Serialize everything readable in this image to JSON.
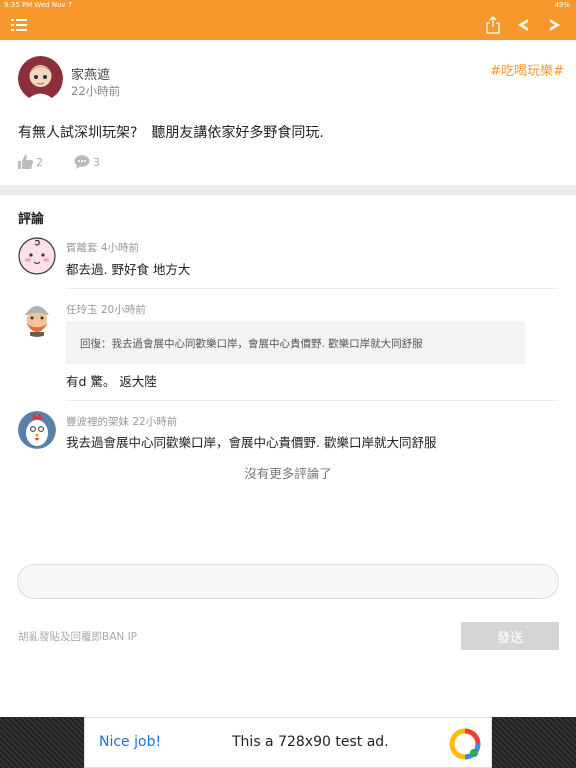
{
  "status_bar": {
    "time_date": "9:35 PM   Wed Nov 7",
    "battery": "49%"
  },
  "nav": {
    "icons": [
      "list-icon",
      "share-icon",
      "back-arrow-icon",
      "forward-arrow-icon"
    ]
  },
  "post": {
    "author": "家燕遮",
    "time": "22小時前",
    "tag": "#吃喝玩樂#",
    "content": "有無人試深圳玩架?　聽朋友講依家好多野食同玩.",
    "likes": "2",
    "comments": "3"
  },
  "comments_section": {
    "title": "評論",
    "items": [
      {
        "meta": "賓離套 4小時前",
        "text": "都去過. 野好食 地方大"
      },
      {
        "meta": "任玲玉 20小時前",
        "quote": "回復：我去過會展中心同歡樂口岸，會展中心貴價野. 歡樂口岸就大同舒服",
        "text": "有d 驚。 返大陸"
      },
      {
        "meta": "豐波裡的架妹 22小時前",
        "text": "我去過會展中心同歡樂口岸，會展中心貴價野. 歡樂口岸就大同舒服"
      }
    ],
    "no_more": "沒有更多評論了"
  },
  "reply": {
    "placeholder": "",
    "warning": "胡亂發貼及回覆即BAN IP",
    "send_label": "發送"
  },
  "ad": {
    "nice": "Nice job!",
    "text": "This a 728x90 test ad."
  },
  "colors": {
    "accent": "#f7982c",
    "divider": "#ececec",
    "send_disabled": "#d5d5d5"
  }
}
